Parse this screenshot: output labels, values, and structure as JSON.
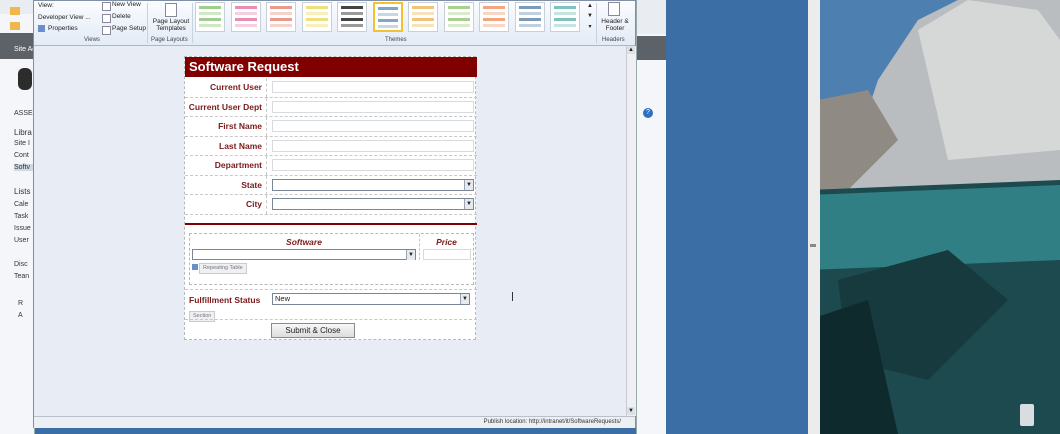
{
  "ribbon": {
    "views_items": [
      "View:",
      "Developer View ...",
      "Properties"
    ],
    "view_actions": [
      "New View",
      "Delete",
      "Page Setup"
    ],
    "page_layout_templates": "Page Layout Templates",
    "header_footer": "Header & Footer",
    "groups": [
      "Views",
      "Page Layouts",
      "Themes",
      "Headers"
    ]
  },
  "themes": [
    {
      "c1": "#9ecf8f",
      "c2": "#cfe9c7"
    },
    {
      "c1": "#e88db3",
      "c2": "#f6cfe0"
    },
    {
      "c1": "#e89b8a",
      "c2": "#f6d3ca"
    },
    {
      "c1": "#f0e07a",
      "c2": "#f8efbd"
    },
    {
      "c1": "#444444",
      "c2": "#9a9a9a"
    },
    {
      "c1": "#7fa7c8",
      "c2": "#c5d8e8"
    },
    {
      "c1": "#f0c27a",
      "c2": "#f8e2bd"
    },
    {
      "c1": "#a9d08e",
      "c2": "#d9ebcc"
    },
    {
      "c1": "#f2a57f",
      "c2": "#f9d6c3"
    },
    {
      "c1": "#7a9cb8",
      "c2": "#c0d0de"
    },
    {
      "c1": "#7fc2c0",
      "c2": "#c6e4e3"
    }
  ],
  "form": {
    "title": "Software Request",
    "fields": [
      {
        "label": "Current User"
      },
      {
        "label": "Current User Dept"
      },
      {
        "label": "First Name"
      },
      {
        "label": "Last Name"
      },
      {
        "label": "Department"
      },
      {
        "label": "State"
      },
      {
        "label": "City"
      }
    ],
    "table": {
      "col_software": "Software",
      "col_price": "Price",
      "tag": "Repeating Table"
    },
    "fulfillment": {
      "label": "Fulfillment Status",
      "value": "New"
    },
    "section_tag": "Section",
    "submit_label": "Submit & Close"
  },
  "status": {
    "publish_location": "Publish location: http://intranet/it/SoftwareRequests/"
  },
  "sidebar_left": {
    "items": [
      "Site Ac",
      "ASSE",
      "Libra",
      "Site I",
      "Cont",
      "Softv",
      "Lists",
      "Cale",
      "Task",
      "Issue",
      "User",
      "Disc",
      "Tean",
      "R",
      "A"
    ]
  }
}
